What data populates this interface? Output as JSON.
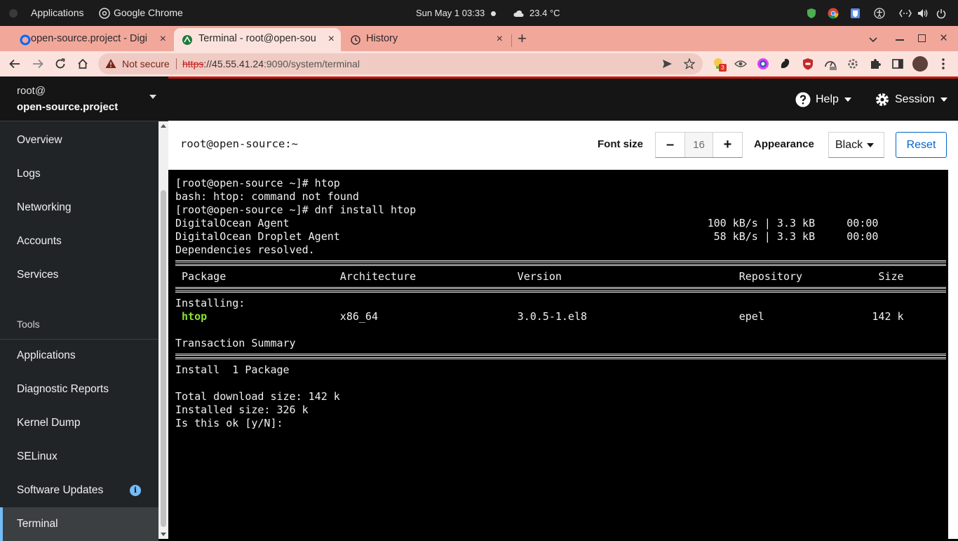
{
  "system": {
    "activities": "Applications",
    "app_name": "Google Chrome",
    "clock": "Sun May 1  03:33",
    "weather": "23.4 °C"
  },
  "browser": {
    "tabs": [
      {
        "label": "open-source.project - Digi",
        "active": false
      },
      {
        "label": "Terminal - root@open-sou",
        "active": true
      },
      {
        "label": "History",
        "active": false
      }
    ],
    "new_tab": "+",
    "close": "×",
    "security": "Not secure",
    "url_scheme": "https",
    "url_host": "://45.55.41.24",
    "url_path": ":9090/system/terminal",
    "extension_badge": "3"
  },
  "cockpit": {
    "host": {
      "user": "root@",
      "name": "open-source.project"
    },
    "nav": [
      {
        "label": "Overview"
      },
      {
        "label": "Logs"
      },
      {
        "label": "Networking"
      },
      {
        "label": "Accounts"
      },
      {
        "label": "Services"
      }
    ],
    "tools_heading": "Tools",
    "tools": [
      {
        "label": "Applications"
      },
      {
        "label": "Diagnostic Reports"
      },
      {
        "label": "Kernel Dump"
      },
      {
        "label": "SELinux"
      },
      {
        "label": "Software Updates"
      },
      {
        "label": "Terminal"
      }
    ],
    "help": "Help",
    "session": "Session",
    "terminal": {
      "title": "root@open-source:~",
      "font_size_label": "Font size",
      "font_size": "16",
      "minus": "–",
      "plus": "+",
      "appearance_label": "Appearance",
      "appearance": "Black",
      "reset": "Reset",
      "lines": [
        "[root@open-source ~]# htop",
        "bash: htop: command not found",
        "[root@open-source ~]# dnf install htop",
        "DigitalOcean Agent                                                                  100 kB/s | 3.3 kB     00:00",
        "DigitalOcean Droplet Agent                                                           58 kB/s | 3.3 kB     00:00",
        "Dependencies resolved.",
        " Package                  Architecture                Version                            Repository            Size",
        "Installing:",
        "                          x86_64                      3.0.5-1.el8                        epel                 142 k",
        "Transaction Summary",
        "Install  1 Package",
        "Total download size: 142 k",
        "Installed size: 326 k",
        "Is this ok [y/N]: "
      ],
      "package_name": " htop"
    }
  }
}
